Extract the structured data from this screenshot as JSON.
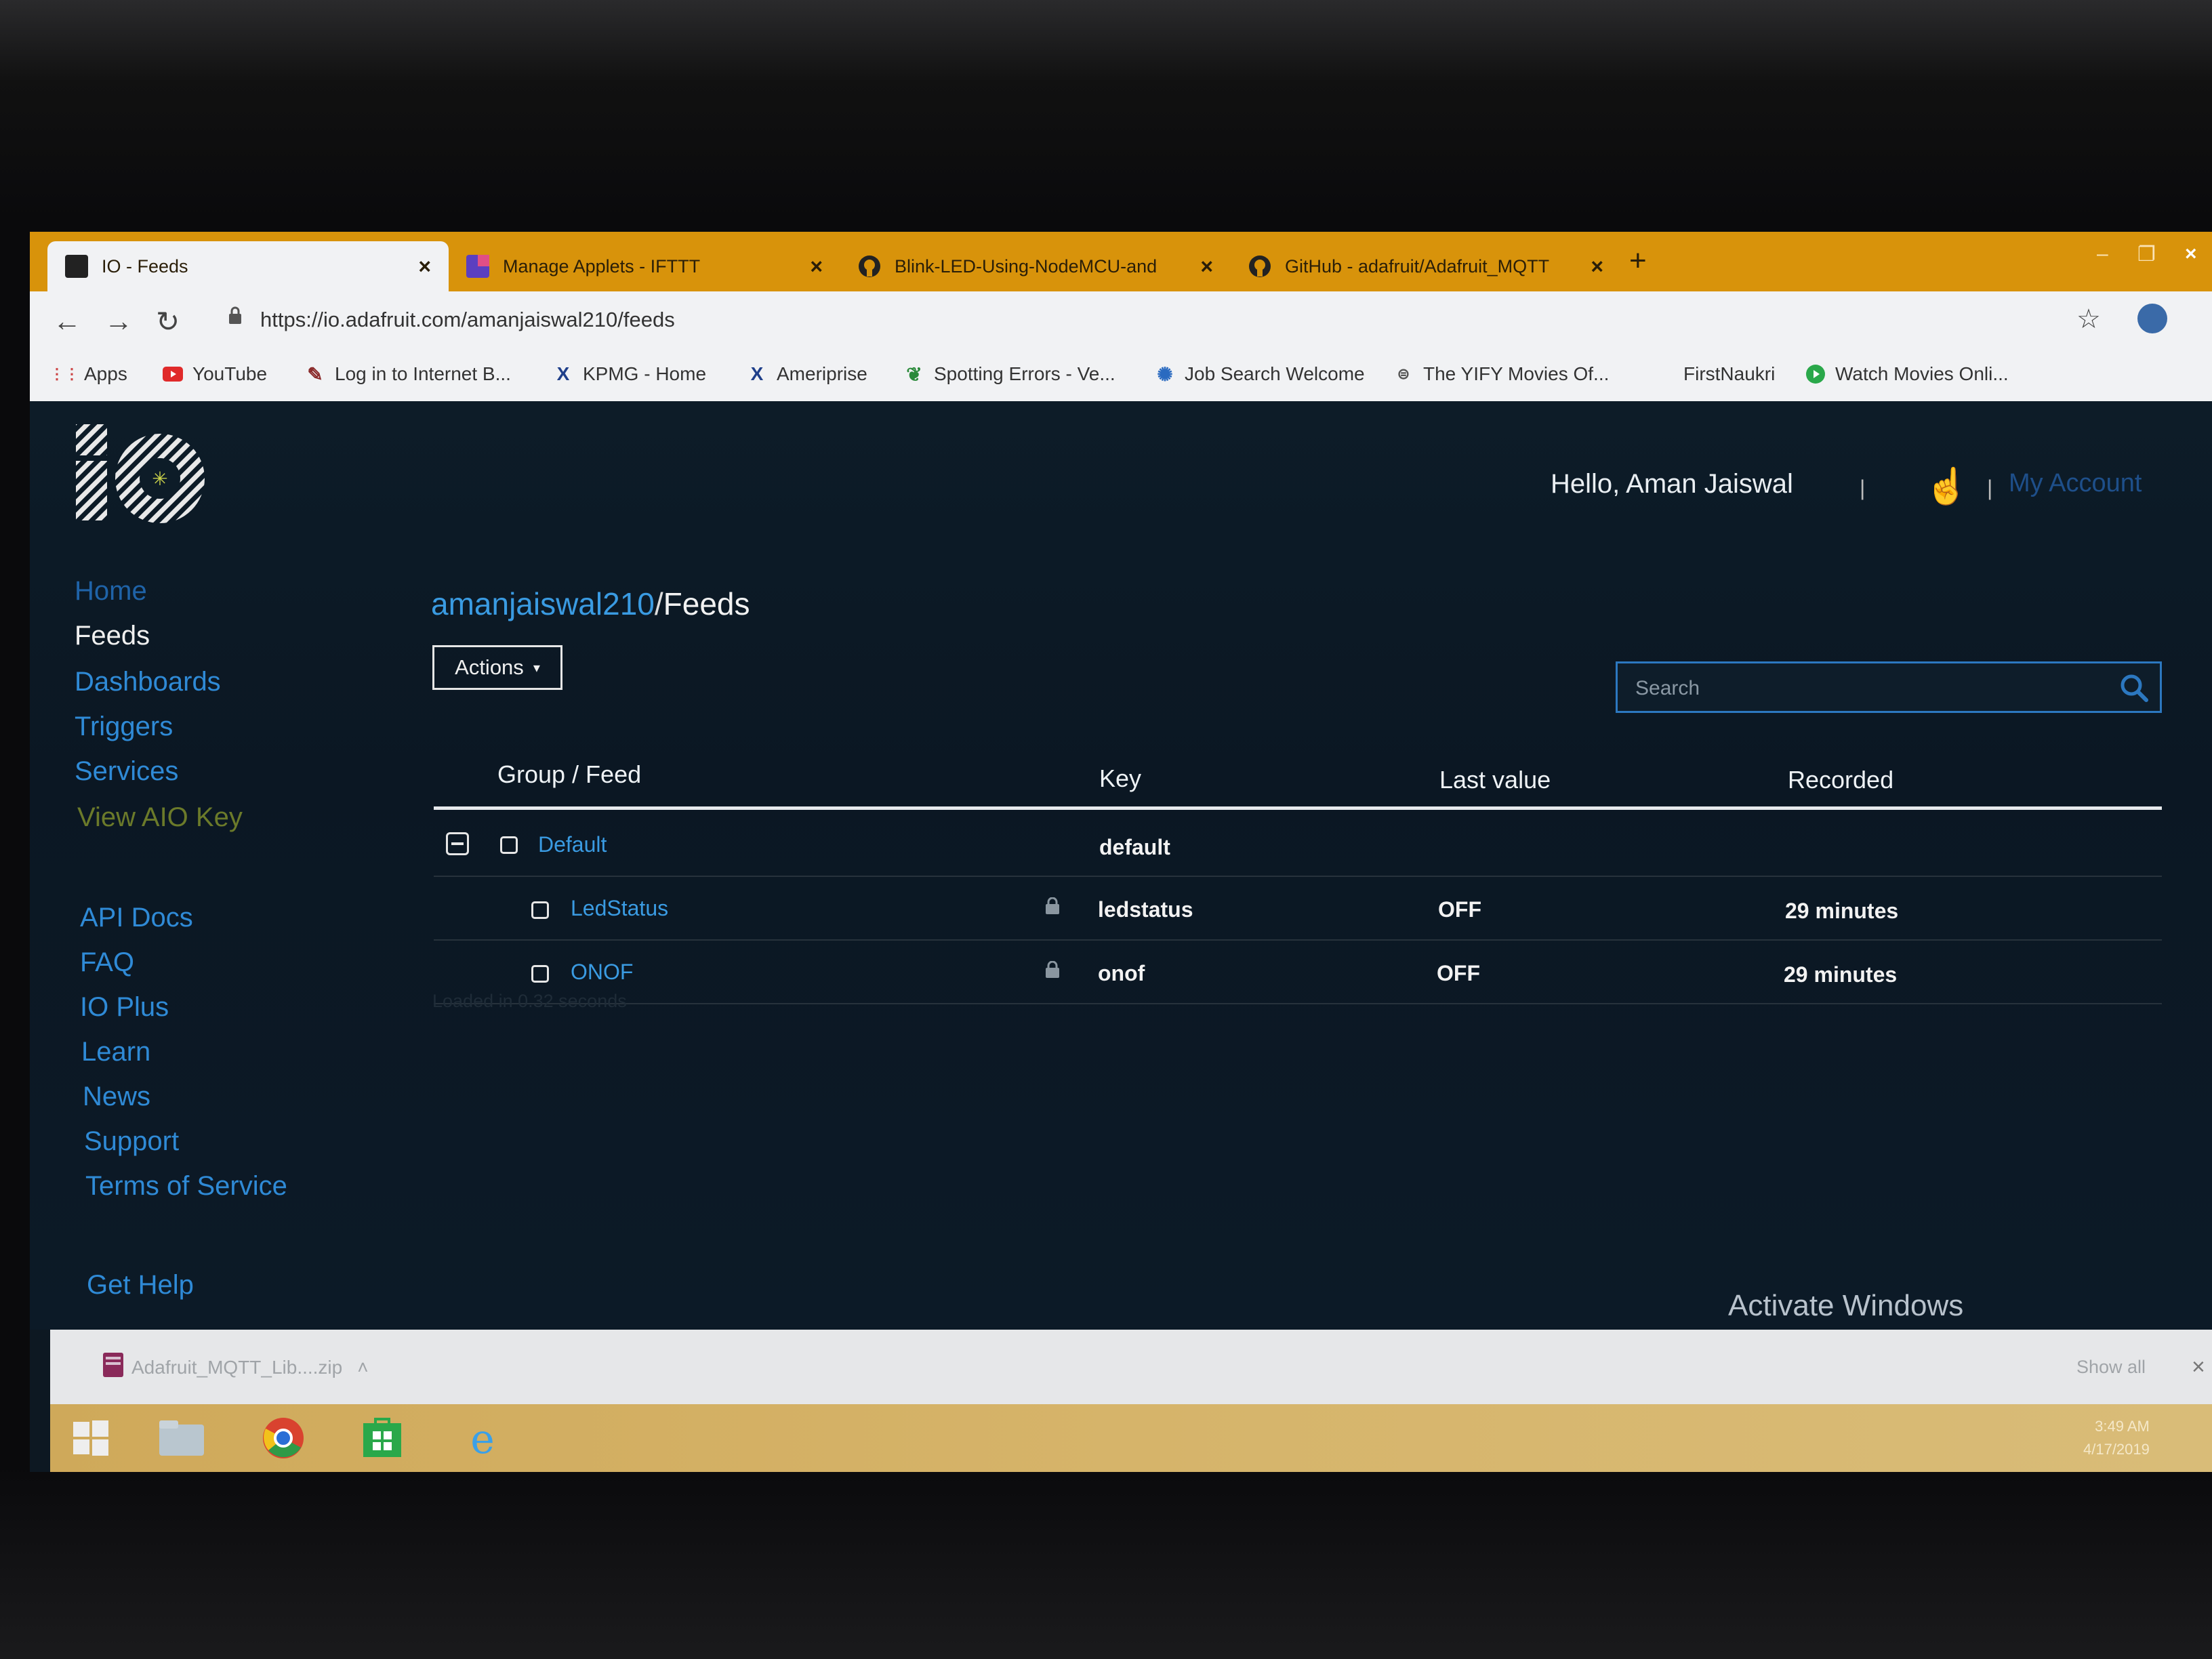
{
  "browser": {
    "tabs": [
      {
        "title": "IO - Feeds",
        "active": true
      },
      {
        "title": "Manage Applets - IFTTT",
        "active": false
      },
      {
        "title": "Blink-LED-Using-NodeMCU-and",
        "active": false
      },
      {
        "title": "GitHub - adafruit/Adafruit_MQTT",
        "active": false
      }
    ],
    "new_tab": "+",
    "url": "https://io.adafruit.com/amanjaiswal210/feeds",
    "bookmarks": [
      {
        "label": "Apps"
      },
      {
        "label": "YouTube"
      },
      {
        "label": "Log in to Internet B..."
      },
      {
        "label": "KPMG - Home"
      },
      {
        "label": "Ameriprise"
      },
      {
        "label": "Spotting Errors - Ve..."
      },
      {
        "label": "Job Search Welcome"
      },
      {
        "label": "The YIFY Movies Of..."
      },
      {
        "label": "FirstNaukri"
      },
      {
        "label": "Watch Movies Onli..."
      }
    ]
  },
  "header": {
    "greeting": "Hello, Aman Jaiswal",
    "separator": "|",
    "my_account": "My Account"
  },
  "sidebar": {
    "primary": [
      {
        "label": "Home",
        "color": "#1f63a8"
      },
      {
        "label": "Feeds",
        "color": "#f0f0f0"
      },
      {
        "label": "Dashboards",
        "color": "#2f8ad6"
      },
      {
        "label": "Triggers",
        "color": "#2f8ad6"
      },
      {
        "label": "Services",
        "color": "#2f8ad6"
      },
      {
        "label": "View AIO Key",
        "color": "#6b7a2a"
      }
    ],
    "secondary": [
      {
        "label": "API Docs"
      },
      {
        "label": "FAQ"
      },
      {
        "label": "IO Plus"
      },
      {
        "label": "Learn"
      },
      {
        "label": "News"
      },
      {
        "label": "Support"
      },
      {
        "label": "Terms of Service"
      }
    ],
    "help": "Get Help"
  },
  "main": {
    "breadcrumb": {
      "user": "amanjaiswal210",
      "sep": "/",
      "page": "Feeds"
    },
    "actions_label": "Actions",
    "search_placeholder": "Search",
    "columns": [
      "Group / Feed",
      "Key",
      "Last value",
      "Recorded"
    ],
    "group": {
      "name": "Default",
      "key": "default"
    },
    "feeds": [
      {
        "name": "LedStatus",
        "key": "ledstatus",
        "last_value": "OFF",
        "recorded": "29 minutes"
      },
      {
        "name": "ONOF",
        "key": "onof",
        "last_value": "OFF",
        "recorded": "29 minutes"
      }
    ],
    "loaded_text": "Loaded in 0.32 seconds",
    "watermark": "Activate Windows"
  },
  "download_bar": {
    "file": "Adafruit_MQTT_Lib....zip",
    "show_all": "Show all",
    "close": "×"
  },
  "taskbar": {
    "time": "3:49 AM",
    "date": "4/17/2019"
  },
  "colors": {
    "accent": "#3a9be2",
    "tabbar": "#d8930b",
    "page_bg": "#0d1c28"
  }
}
